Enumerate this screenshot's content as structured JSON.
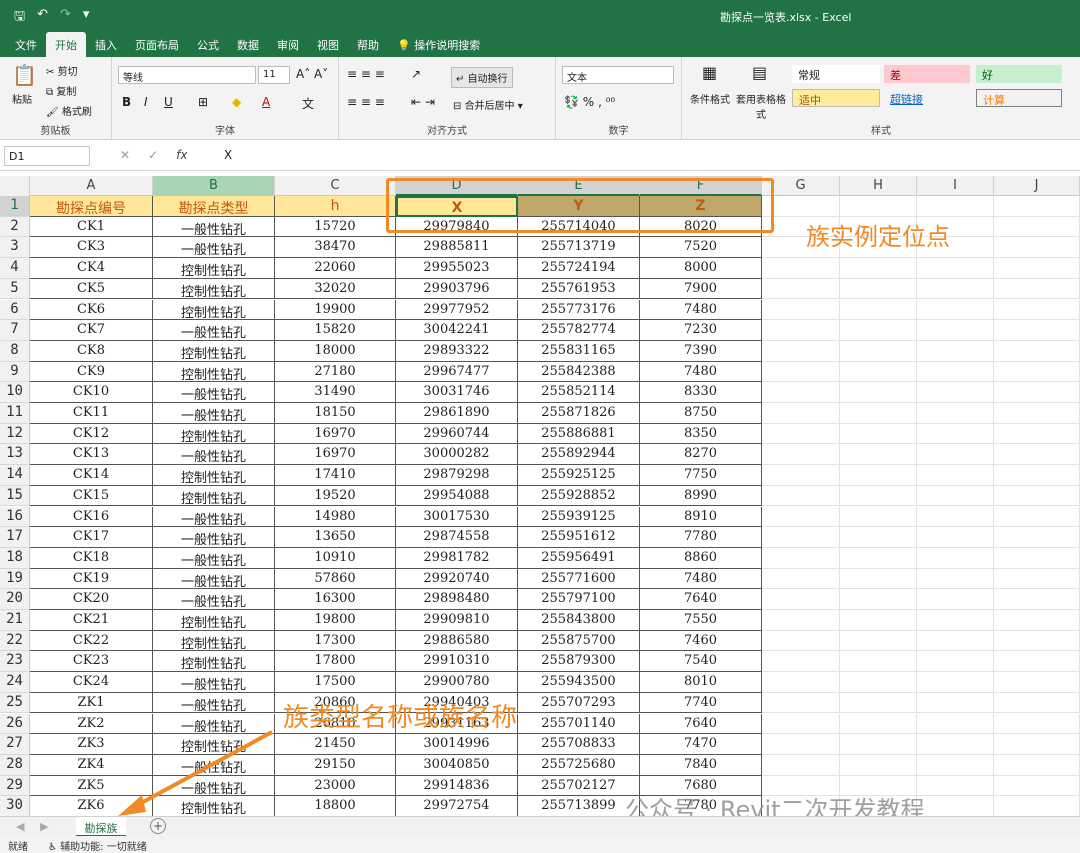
{
  "titlebar": {
    "doc_title": "勘探点一览表.xlsx - Excel"
  },
  "tabs": [
    "文件",
    "开始",
    "插入",
    "页面布局",
    "公式",
    "数据",
    "审阅",
    "视图",
    "帮助",
    "操作说明搜索"
  ],
  "ribbon": {
    "clipboard": {
      "paste": "粘贴",
      "cut": "剪切",
      "copy": "复制",
      "format_painter": "格式刷",
      "label": "剪贴板"
    },
    "font": {
      "name": "等线",
      "size": "11",
      "label": "字体"
    },
    "align": {
      "wrap": "自动换行",
      "merge": "合并后居中",
      "label": "对齐方式"
    },
    "number": {
      "format": "文本",
      "label": "数字"
    },
    "styles": {
      "cond_format": "条件格式",
      "table_format": "套用表格格式",
      "normal": "常规",
      "bad": "差",
      "good": "好",
      "neutral": "适中",
      "hyperlink": "超链接",
      "calc": "计算",
      "label": "样式"
    }
  },
  "formula_bar": {
    "name_box": "D1",
    "value": "X"
  },
  "columns": [
    "A",
    "B",
    "C",
    "D",
    "E",
    "F",
    "G",
    "H",
    "I",
    "J"
  ],
  "header_row": [
    "勘探点编号",
    "勘探点类型",
    "h",
    "X",
    "Y",
    "Z"
  ],
  "rows": [
    [
      "CK1",
      "一般性钻孔",
      "15720",
      "29979840",
      "255714040",
      "8020"
    ],
    [
      "CK3",
      "一般性钻孔",
      "38470",
      "29885811",
      "255713719",
      "7520"
    ],
    [
      "CK4",
      "控制性钻孔",
      "22060",
      "29955023",
      "255724194",
      "8000"
    ],
    [
      "CK5",
      "控制性钻孔",
      "32020",
      "29903796",
      "255761953",
      "7900"
    ],
    [
      "CK6",
      "控制性钻孔",
      "19900",
      "29977952",
      "255773176",
      "7480"
    ],
    [
      "CK7",
      "一般性钻孔",
      "15820",
      "30042241",
      "255782774",
      "7230"
    ],
    [
      "CK8",
      "控制性钻孔",
      "18000",
      "29893322",
      "255831165",
      "7390"
    ],
    [
      "CK9",
      "控制性钻孔",
      "27180",
      "29967477",
      "255842388",
      "7480"
    ],
    [
      "CK10",
      "一般性钻孔",
      "31490",
      "30031746",
      "255852114",
      "8330"
    ],
    [
      "CK11",
      "一般性钻孔",
      "18150",
      "29861890",
      "255871826",
      "8750"
    ],
    [
      "CK12",
      "控制性钻孔",
      "16970",
      "29960744",
      "255886881",
      "8350"
    ],
    [
      "CK13",
      "一般性钻孔",
      "16970",
      "30000282",
      "255892944",
      "8270"
    ],
    [
      "CK14",
      "控制性钻孔",
      "17410",
      "29879298",
      "255925125",
      "7750"
    ],
    [
      "CK15",
      "控制性钻孔",
      "19520",
      "29954088",
      "255928852",
      "8990"
    ],
    [
      "CK16",
      "一般性钻孔",
      "14980",
      "30017530",
      "255939125",
      "8910"
    ],
    [
      "CK17",
      "一般性钻孔",
      "13650",
      "29874558",
      "255951612",
      "7780"
    ],
    [
      "CK18",
      "一般性钻孔",
      "10910",
      "29981782",
      "255956491",
      "8860"
    ],
    [
      "CK19",
      "一般性钻孔",
      "57860",
      "29920740",
      "255771600",
      "7480"
    ],
    [
      "CK20",
      "一般性钻孔",
      "16300",
      "29898480",
      "255797100",
      "7640"
    ],
    [
      "CK21",
      "控制性钻孔",
      "19800",
      "29909810",
      "255843800",
      "7550"
    ],
    [
      "CK22",
      "控制性钻孔",
      "17300",
      "29886580",
      "255875700",
      "7460"
    ],
    [
      "CK23",
      "控制性钻孔",
      "17800",
      "29910310",
      "255879300",
      "7540"
    ],
    [
      "CK24",
      "一般性钻孔",
      "17500",
      "29900780",
      "255943500",
      "8010"
    ],
    [
      "ZK1",
      "一般性钻孔",
      "20860",
      "29940403",
      "255707293",
      "7740"
    ],
    [
      "ZK2",
      "一般性钻孔",
      "26810",
      "29931163",
      "255701140",
      "7640"
    ],
    [
      "ZK3",
      "控制性钻孔",
      "21450",
      "30014996",
      "255708833",
      "7470"
    ],
    [
      "ZK4",
      "一般性钻孔",
      "29150",
      "30040850",
      "255725680",
      "7840"
    ],
    [
      "ZK5",
      "一般性钻孔",
      "23000",
      "29914836",
      "255702127",
      "7680"
    ],
    [
      "ZK6",
      "控制性钻孔",
      "18800",
      "29972754",
      "255713899",
      "7780"
    ]
  ],
  "annotations": {
    "instance_point": "族实例定位点",
    "family_name": "族类型名称或族名称"
  },
  "sheet_tab": "勘探族",
  "status": {
    "ready": "就绪",
    "accessibility": "辅助功能: 一切就绪"
  },
  "watermark": "公众号 · Revit二次开发教程",
  "colors": {
    "excel_green": "#217346",
    "annotation_orange": "#f08a24",
    "header_yellow": "#ffe699"
  }
}
